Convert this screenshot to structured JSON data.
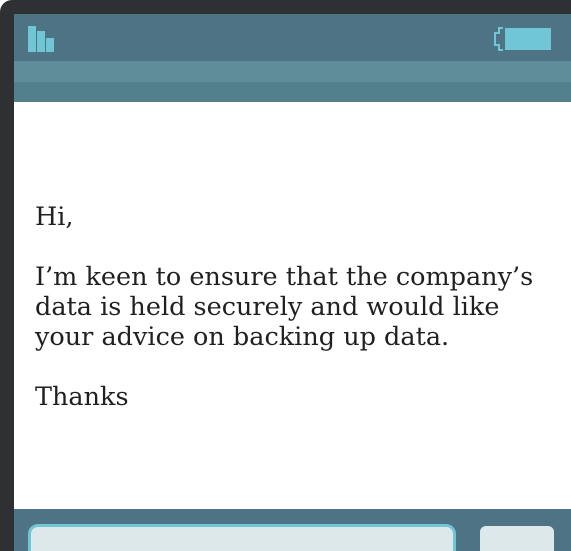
{
  "message": {
    "greeting": "Hi,",
    "body_line1": "I’m keen to ensure that the company’s",
    "body_line2": "data is held securely and would like",
    "body_line3": "your advice on backing up data.",
    "signoff": "Thanks"
  },
  "reply": {
    "value": "",
    "placeholder": ""
  },
  "send_button": {
    "label": ""
  },
  "icons": {
    "status_left": "signal-icon",
    "status_right": "battery-icon"
  },
  "colors": {
    "bezel": "#2e3033",
    "header": "#4e7385",
    "band_light": "#5f8e9a",
    "accent": "#71c6d6",
    "input_fill": "#dde8ea"
  }
}
